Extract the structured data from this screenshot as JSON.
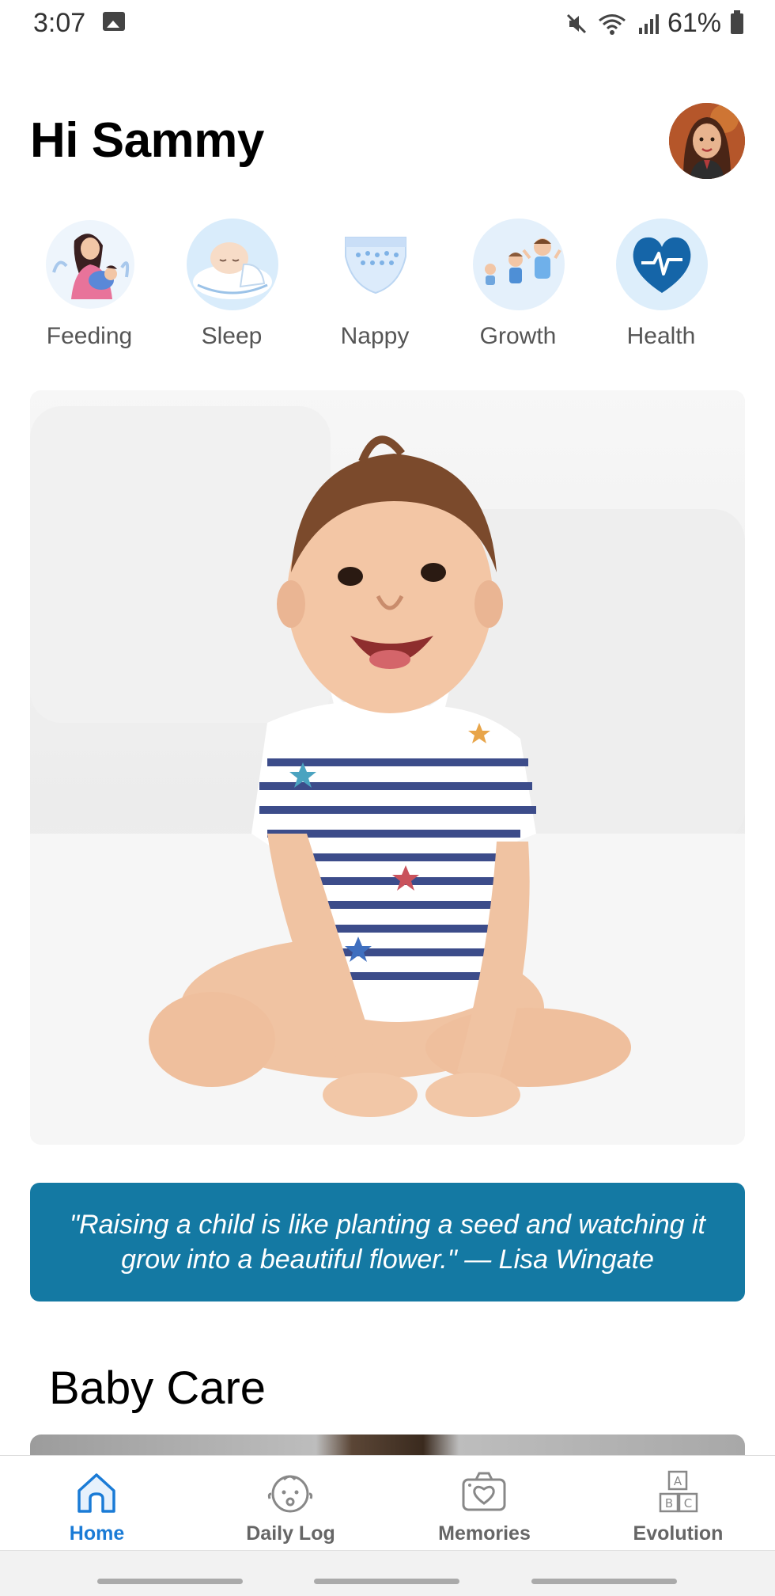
{
  "status_bar": {
    "time": "3:07",
    "battery": "61%",
    "icons": [
      "gallery-icon",
      "mute-icon",
      "wifi-icon",
      "signal-icon",
      "battery-icon"
    ]
  },
  "header": {
    "greeting": "Hi Sammy"
  },
  "categories": [
    {
      "label": "Feeding",
      "icon": "breastfeeding-icon"
    },
    {
      "label": "Sleep",
      "icon": "sleeping-baby-icon"
    },
    {
      "label": "Nappy",
      "icon": "diaper-icon"
    },
    {
      "label": "Growth",
      "icon": "growth-kids-icon"
    },
    {
      "label": "Health",
      "icon": "heart-pulse-icon"
    }
  ],
  "quote": {
    "text": "\"Raising a child is like planting a seed and watching it grow into a beautiful flower.\" — Lisa Wingate"
  },
  "baby_care": {
    "title": "Baby Care"
  },
  "bottom_nav": {
    "items": [
      {
        "label": "Home",
        "icon": "home-icon",
        "active": true
      },
      {
        "label": "Daily Log",
        "icon": "baby-face-icon",
        "active": false
      },
      {
        "label": "Memories",
        "icon": "camera-heart-icon",
        "active": false
      },
      {
        "label": "Evolution",
        "icon": "abc-blocks-icon",
        "active": false
      }
    ]
  },
  "colors": {
    "accent": "#1a7bd6",
    "quote_bg": "#1479a3",
    "health_blue": "#1565a8",
    "label_grey": "#555555"
  }
}
